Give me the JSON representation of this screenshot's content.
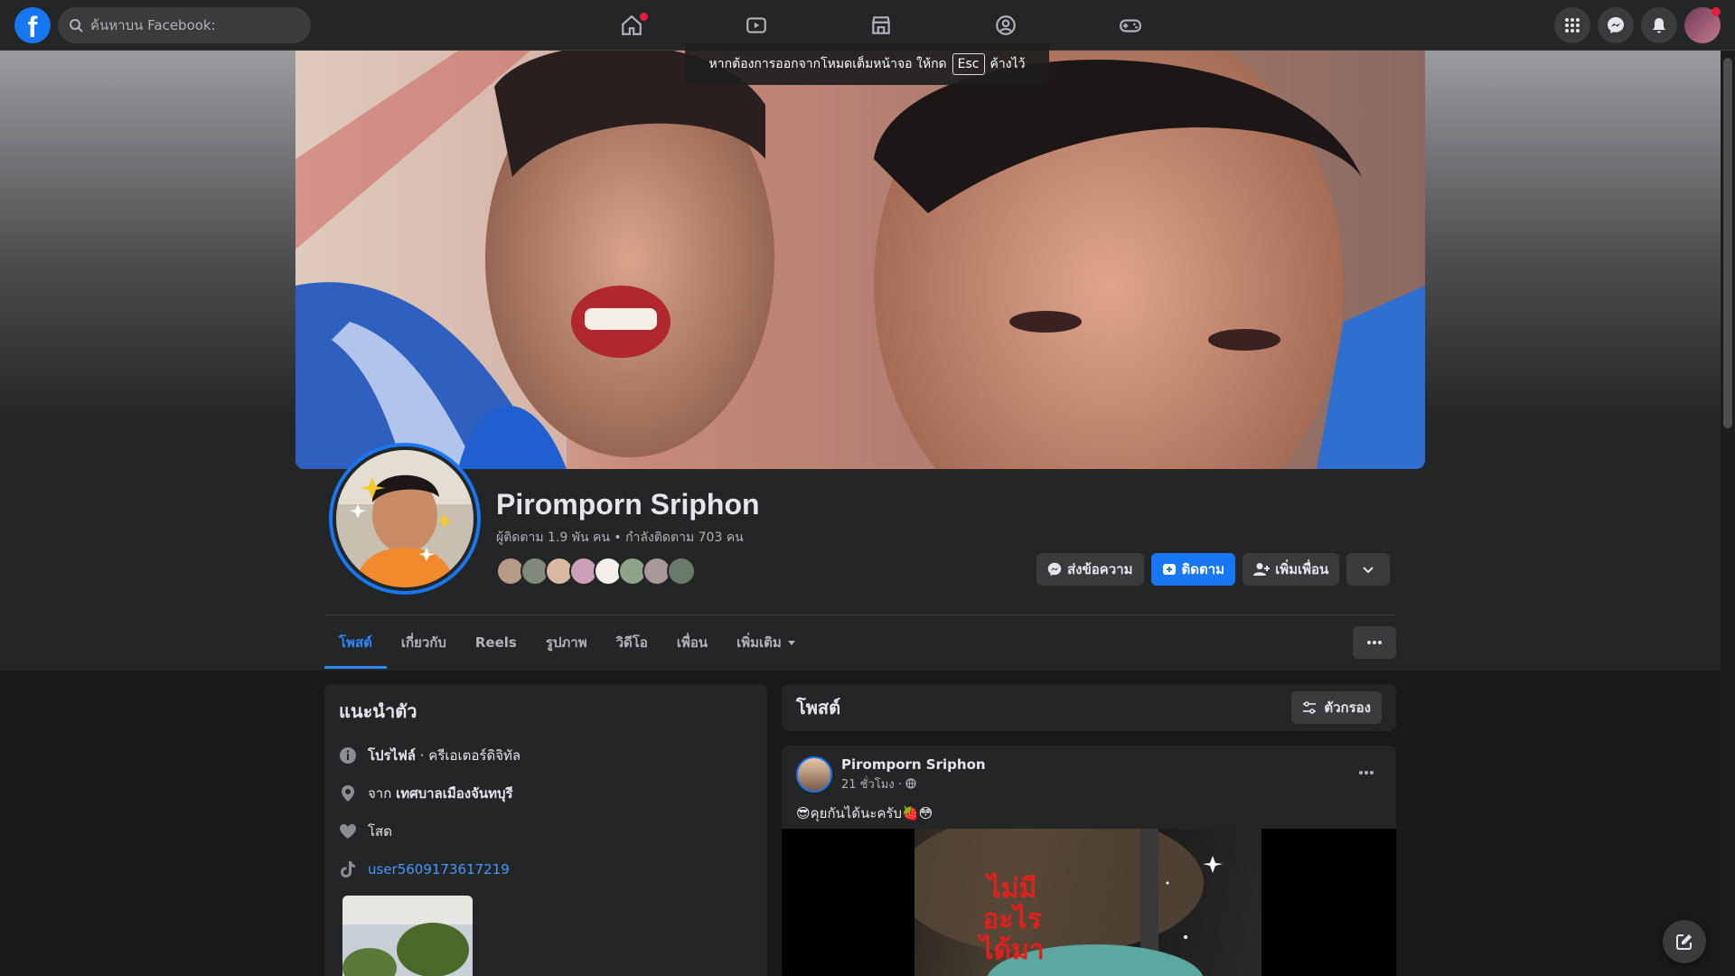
{
  "nav": {
    "logo_letter": "f",
    "search_placeholder": "ค้นหาบน Facebook:"
  },
  "toast": {
    "text_before": "หากต้องการออกจากโหมดเต็มหน้าจอ ให้กด",
    "key": "Esc",
    "text_after": "ค้างไว้"
  },
  "profile": {
    "name": "Piromporn Sriphon",
    "stats": "ผู้ติดตาม 1.9 พัน คน • กำลังติดตาม 703 คน"
  },
  "actions": {
    "message": "ส่งข้อความ",
    "follow": "ติดตาม",
    "add_friend": "เพิ่มเพื่อน"
  },
  "tabs": [
    {
      "label": "โพสต์"
    },
    {
      "label": "เกี่ยวกับ"
    },
    {
      "label": "Reels"
    },
    {
      "label": "รูปภาพ"
    },
    {
      "label": "วิดีโอ"
    },
    {
      "label": "เพื่อน"
    },
    {
      "label": "เพิ่มเติม"
    }
  ],
  "intro": {
    "title": "แนะนำตัว",
    "profile_label": "โปรไฟล์",
    "profile_category": " · ครีเอเตอร์ดิจิทัล",
    "from_prefix": "จาก ",
    "from_place": "เทศบาลเมืองจันทบุรี",
    "relationship": "โสด",
    "tiktok": "user5609173617219"
  },
  "posts": {
    "title": "โพสต์",
    "filter": "ตัวกรอง"
  },
  "post": {
    "author": "Piromporn Sriphon",
    "time": "21 ชั่วโมง ·",
    "text": "😎คุยกันได้นะครับ🍓😳",
    "video_caption": "ไม่มี อะไร ได้มา"
  },
  "colors": {
    "brand": "#1877f2",
    "link": "#4599ff",
    "notification": "#e41e3f"
  }
}
